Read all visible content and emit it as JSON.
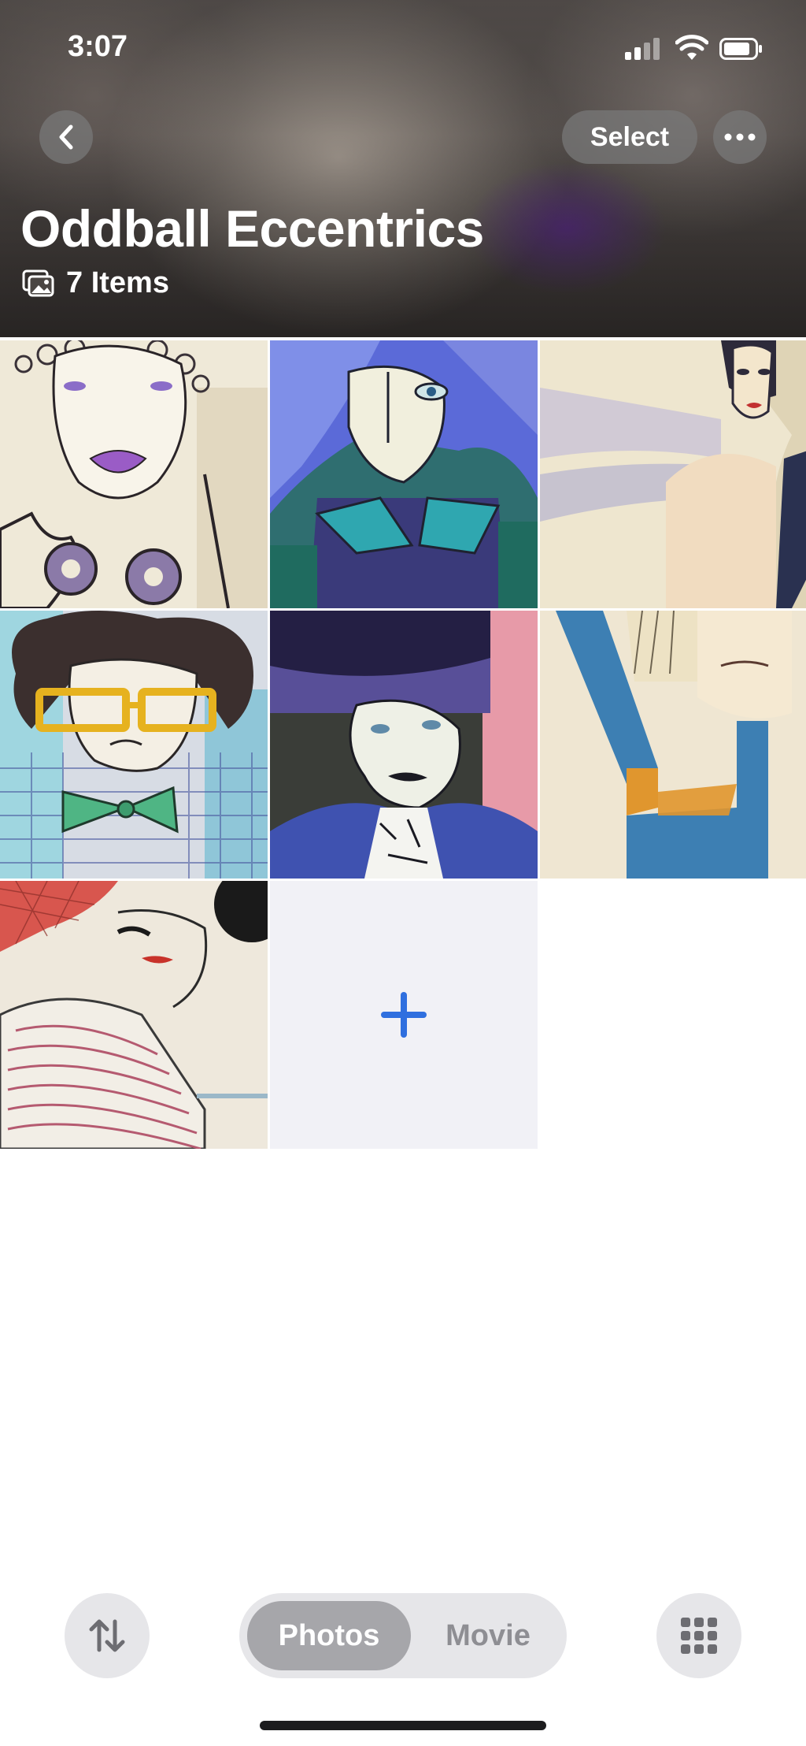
{
  "status_bar": {
    "time": "3:07"
  },
  "header": {
    "select_label": "Select",
    "album_title": "Oddball Eccentrics",
    "item_count": "7 Items"
  },
  "photos": [
    {
      "name": "purple-lips-portrait"
    },
    {
      "name": "blue-hair-portrait"
    },
    {
      "name": "pale-figure-portrait"
    },
    {
      "name": "yellow-glasses-bowtie-portrait"
    },
    {
      "name": "dark-hat-man-portrait"
    },
    {
      "name": "blue-dress-portrait"
    },
    {
      "name": "red-hat-woman-portrait"
    }
  ],
  "bottom_bar": {
    "segment_photos": "Photos",
    "segment_movie": "Movie",
    "selected_segment": "Photos"
  },
  "colors": {
    "accent": "#2f6fdf",
    "segment_selected": "#a6a6aa",
    "segment_bg": "#e6e6e9"
  }
}
